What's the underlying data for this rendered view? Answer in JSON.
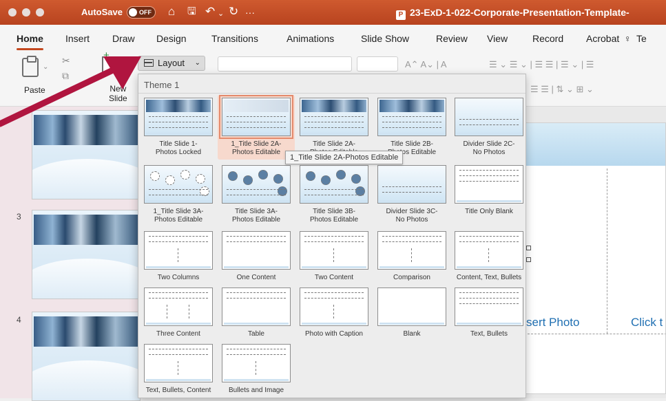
{
  "titlebar": {
    "autosave_label": "AutoSave",
    "autosave_state": "OFF",
    "more_label": "···",
    "document_title": "23-ExD-1-022-Corporate-Presentation-Template-"
  },
  "ribbon_tabs": [
    "Home",
    "Insert",
    "Draw",
    "Design",
    "Transitions",
    "Animations",
    "Slide Show",
    "Review",
    "View",
    "Record",
    "Acrobat",
    "Te"
  ],
  "toolbar": {
    "paste_label": "Paste",
    "new_slide_label": "New\nSlide",
    "layout_label": "Layout"
  },
  "gallery": {
    "heading": "Theme 1",
    "tooltip": "1_Title Slide 2A-Photos Editable",
    "layouts": [
      {
        "label": "Title Slide 1-\nPhotos Locked",
        "style": "photos"
      },
      {
        "label": "1_Title Slide 2A-\nPhotos Editable",
        "style": "placeholders",
        "selected": true
      },
      {
        "label": "Title Slide 2A-\nPhotos Editable",
        "style": "photos"
      },
      {
        "label": "Title Slide 2B-\nPhotos Editable",
        "style": "photos"
      },
      {
        "label": "Divider Slide 2C-\nNo Photos",
        "style": "plain"
      },
      {
        "label": "1_Title Slide 3A-\nPhotos Editable",
        "style": "circles-empty"
      },
      {
        "label": "Title Slide 3A-\nPhotos Editable",
        "style": "circles"
      },
      {
        "label": "Title Slide 3B-\nPhotos Editable",
        "style": "circles"
      },
      {
        "label": "Divider Slide 3C-\nNo Photos",
        "style": "plain"
      },
      {
        "label": "Title Only Blank",
        "style": "title-only"
      },
      {
        "label": "Two Columns",
        "style": "two-col"
      },
      {
        "label": "One Content",
        "style": "one-content"
      },
      {
        "label": "Two Content",
        "style": "two-col"
      },
      {
        "label": "Comparison",
        "style": "comparison"
      },
      {
        "label": "Content, Text, Bullets",
        "style": "two-col"
      },
      {
        "label": "Three Content",
        "style": "three-col"
      },
      {
        "label": "Table",
        "style": "one-content"
      },
      {
        "label": "Photo with Caption",
        "style": "two-col"
      },
      {
        "label": "Blank",
        "style": "blank"
      },
      {
        "label": "Text, Bullets",
        "style": "title-only"
      },
      {
        "label": "Text, Bullets, Content",
        "style": "two-col"
      },
      {
        "label": "Bullets and Image",
        "style": "two-col"
      }
    ]
  },
  "slides_panel": {
    "slide_numbers": [
      "3",
      "4"
    ]
  },
  "main_slide": {
    "insert_photo_text": "sert Photo",
    "click_text": "Click t"
  },
  "colors": {
    "titlebar": "#c4481f",
    "accent": "#c4481f",
    "annotation_arrow": "#b0153f",
    "slide_text": "#1f6fb2"
  }
}
